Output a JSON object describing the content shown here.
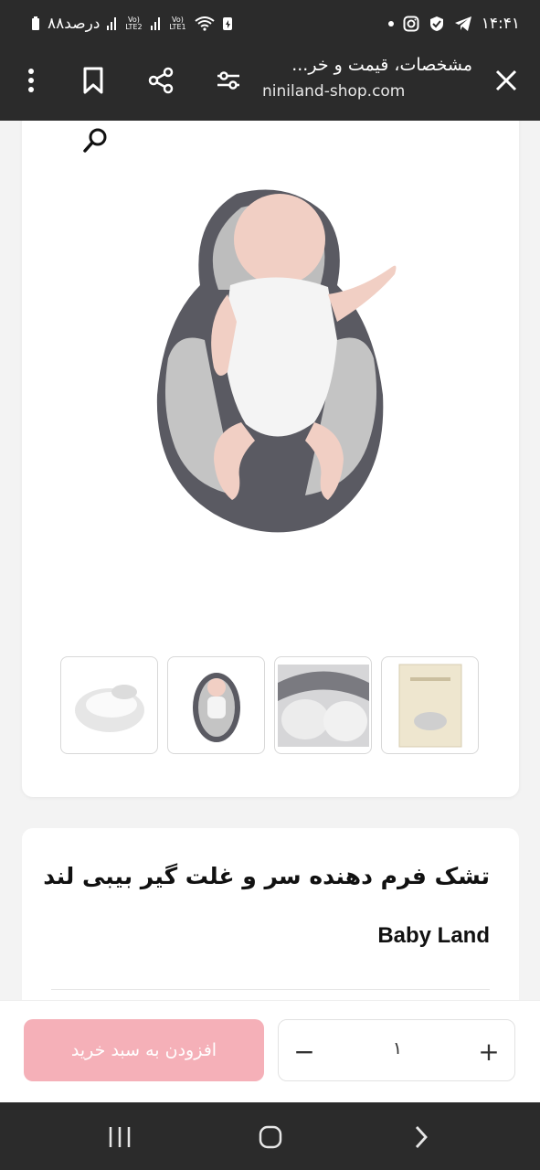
{
  "status_bar": {
    "time": "۱۴:۴۱",
    "battery": "۸۸درصد",
    "sim1_label": "Vo) LTE2",
    "sim2_label": "Vo) LTE1"
  },
  "browser": {
    "page_title": "مشخصات، قیمت و خر...",
    "url": "niniland-shop.com"
  },
  "product": {
    "title": "تشک فرم دهنده سر و غلت گیر بیبی لند",
    "brand": "Baby Land",
    "thumbnails": [
      "thumb-pillow",
      "thumb-baby",
      "thumb-closeup",
      "thumb-box"
    ]
  },
  "cart": {
    "add_label": "افزودن به سبد خرید",
    "quantity": "۱",
    "minus": "−",
    "plus": "+"
  },
  "colors": {
    "accent": "#f5b0b8",
    "bar": "#2b2b2b"
  }
}
